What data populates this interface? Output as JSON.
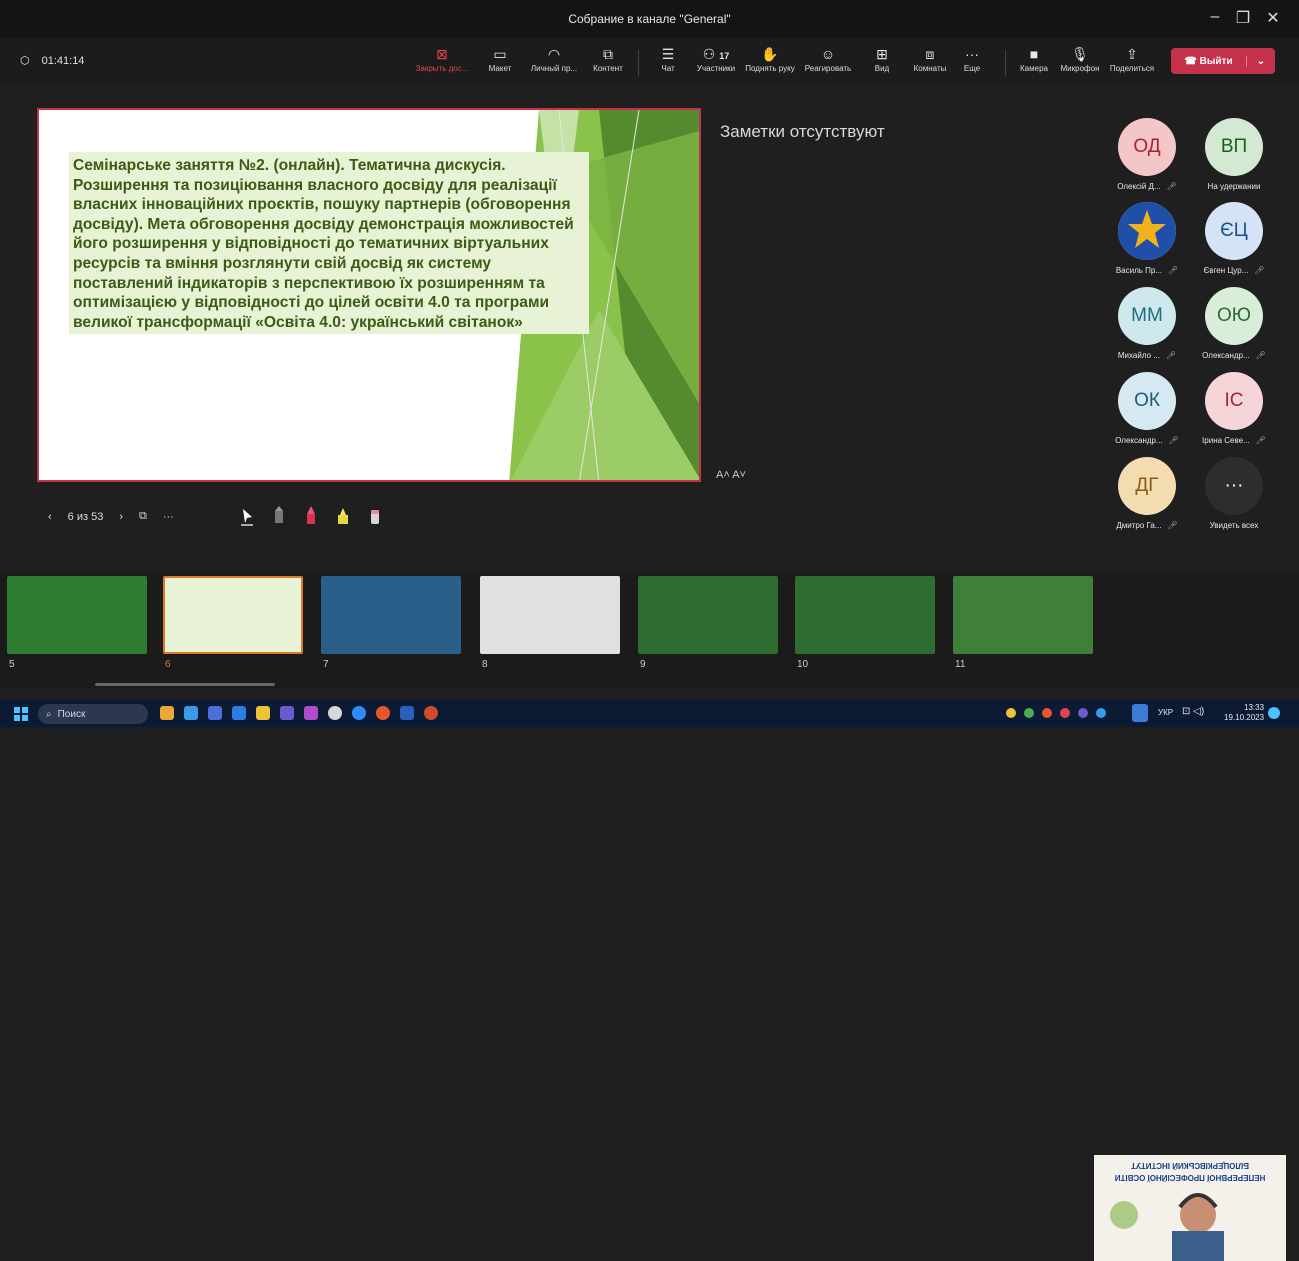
{
  "window": {
    "title": "Собрание в канале \"General\""
  },
  "toolbar": {
    "timer": "01:41:14",
    "buttons": {
      "close_content": "Закрыть дос...",
      "layout": "Макет",
      "personal": "Личный пр...",
      "content": "Контент",
      "chat": "Чат",
      "participants": "Участники",
      "raise_hand": "Поднять руку",
      "react": "Реагировать",
      "view": "Вид",
      "rooms": "Комнаты",
      "more": "Еще",
      "camera": "Камера",
      "mic": "Микрофон",
      "share": "Поделиться"
    },
    "participants_count": "17",
    "leave": "Выйти"
  },
  "slide": {
    "text": "Семінарське заняття №2. (онлайн). Тематична дискусія. Розширення та позиціювання власного досвіду для реалізації  власних інноваційних проєктів, пошуку партнерів (обговорення досвіду). Мета обговорення досвіду демонстрація можливостей його розширення у відповідності до тематичних віртуальних ресурсів та вміння розглянути свій досвід як систему поставлений індикаторів з перспективою їх розширенням  та оптимізацією у відповідності до цілей освіти 4.0 та програми великої трансформації «Освіта 4.0: український світанок»"
  },
  "notes": "Заметки отсутствуют",
  "font_controls": "A˄  A˅",
  "slide_nav": {
    "counter": "6 из 53"
  },
  "participants": [
    {
      "initials": "ОД",
      "name": "Олексій Д...",
      "bg": "#f4c6c8",
      "fg": "#a4262c"
    },
    {
      "initials": "ВП",
      "name": "На удержании",
      "bg": "#d3e9d3",
      "fg": "#1b5e20"
    },
    {
      "initials": "",
      "name": "Василь Пр...",
      "bg": "#ffffff",
      "fg": "#000000"
    },
    {
      "initials": "ЄЦ",
      "name": "Євген Цур...",
      "bg": "#d4e4f6",
      "fg": "#1b4f8a"
    },
    {
      "initials": "ММ",
      "name": "Михайло ...",
      "bg": "#cfe8ed",
      "fg": "#1f6d7a"
    },
    {
      "initials": "ОЮ",
      "name": "Олександр...",
      "bg": "#d8eed8",
      "fg": "#2e6b2e"
    },
    {
      "initials": "ОК",
      "name": "Олександр...",
      "bg": "#d6e8f2",
      "fg": "#1f5b7a"
    },
    {
      "initials": "ІС",
      "name": "Ірина Севе...",
      "bg": "#f6d5d9",
      "fg": "#a4262c"
    },
    {
      "initials": "ДГ",
      "name": "Дмитро Га...",
      "bg": "#f3dcb0",
      "fg": "#8a5a12"
    },
    {
      "initials": "···",
      "name": "Увидеть всех",
      "bg": "#2d2d2d",
      "fg": "#ffffff"
    }
  ],
  "thumbnails": [
    "5",
    "6",
    "7",
    "8",
    "9",
    "10",
    "11"
  ],
  "video_tile": {
    "line1": "БІЛОЦЕРКІВСЬКИЙ ІНСТИТУТ",
    "line2": "НЕПЕРЕРВНОЇ ПРОФЕСІЙНОЇ ОСВІТИ"
  },
  "taskbar": {
    "search": "Поиск",
    "lang": "УКР",
    "time": "13:33",
    "date": "19.10.2023"
  }
}
